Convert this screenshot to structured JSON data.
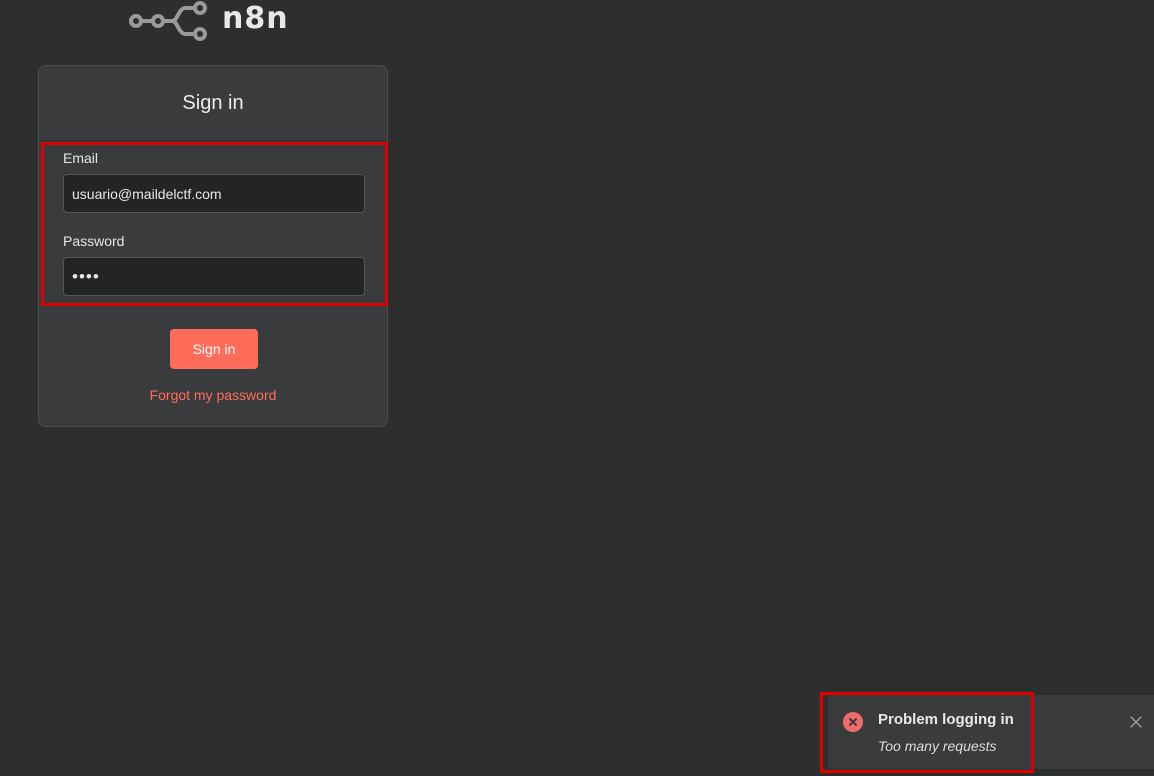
{
  "brand": {
    "name": "n8n",
    "accent": "#ff6d5a"
  },
  "signin": {
    "title": "Sign in",
    "email_label": "Email",
    "email_value": "usuario@maildelctf.com",
    "password_label": "Password",
    "password_value": "abcd",
    "button_label": "Sign in",
    "forgot_label": "Forgot my password"
  },
  "toast": {
    "title": "Problem logging in",
    "message": "Too many requests",
    "icon": "error-circle-icon",
    "close_icon": "close-icon",
    "color": "#f06b6b"
  }
}
